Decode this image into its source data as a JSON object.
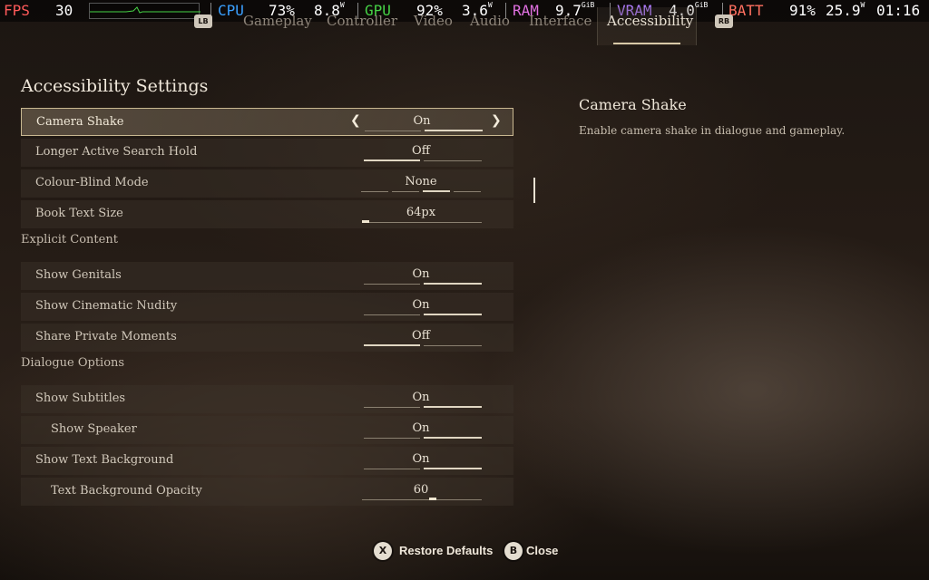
{
  "osd": {
    "fps_label": "FPS",
    "fps_value": "30",
    "cpu_label": "CPU",
    "cpu_pct": "73%",
    "cpu_power": "8.8",
    "cpu_power_unit": "W",
    "gpu_label": "GPU",
    "gpu_pct": "92%",
    "gpu_power": "3.6",
    "gpu_power_unit": "W",
    "ram_label": "RAM",
    "ram_value": "9.7",
    "ram_unit": "GiB",
    "vram_label": "VRAM",
    "vram_value": "4.0",
    "vram_unit": "GiB",
    "batt_label": "BATT",
    "batt_pct": "91%",
    "batt_power": "25.9",
    "batt_power_unit": "W",
    "clock": "01:16",
    "colors": {
      "fps": "#ff5a5a",
      "cpu": "#3aa0ff",
      "gpu": "#46d246",
      "ram": "#e070e0",
      "vram": "#b07cff",
      "batt": "#ff7060"
    }
  },
  "tabs": {
    "left_bumper": "LB",
    "right_bumper": "RB",
    "items": [
      "Gameplay",
      "Controller",
      "Video",
      "Audio",
      "Interface",
      "Accessibility"
    ],
    "active": "Accessibility"
  },
  "settings": {
    "title": "Accessibility Settings",
    "rows": [
      {
        "label": "Camera Shake",
        "value": "On",
        "kind": "toggle",
        "state": "on",
        "selected": true
      },
      {
        "label": "Longer Active Search Hold",
        "value": "Off",
        "kind": "toggle",
        "state": "off"
      },
      {
        "label": "Colour-Blind Mode",
        "value": "None",
        "kind": "multi",
        "option_count": 4,
        "active_option": 2
      },
      {
        "label": "Book Text Size",
        "value": "64px",
        "kind": "slider",
        "level": 0.0
      }
    ],
    "sections": [
      {
        "title": "Explicit Content",
        "rows": [
          {
            "label": "Show Genitals",
            "value": "On",
            "kind": "toggle",
            "state": "on"
          },
          {
            "label": "Show Cinematic Nudity",
            "value": "On",
            "kind": "toggle",
            "state": "on"
          },
          {
            "label": "Share Private Moments",
            "value": "Off",
            "kind": "toggle",
            "state": "off"
          }
        ]
      },
      {
        "title": "Dialogue Options",
        "rows": [
          {
            "label": "Show Subtitles",
            "value": "On",
            "kind": "toggle",
            "state": "on"
          },
          {
            "label": "Show Speaker",
            "value": "On",
            "kind": "toggle",
            "state": "on",
            "indent": true
          },
          {
            "label": "Show Text Background",
            "value": "On",
            "kind": "toggle",
            "state": "on"
          },
          {
            "label": "Text Background Opacity",
            "value": "60",
            "kind": "slider",
            "level": 0.6,
            "indent": true
          }
        ]
      }
    ]
  },
  "description": {
    "title": "Camera Shake",
    "text": "Enable camera shake in dialogue and gameplay."
  },
  "footer": {
    "restore": {
      "icon": "X",
      "label": "Restore Defaults"
    },
    "close": {
      "icon": "B",
      "label": "Close"
    }
  }
}
